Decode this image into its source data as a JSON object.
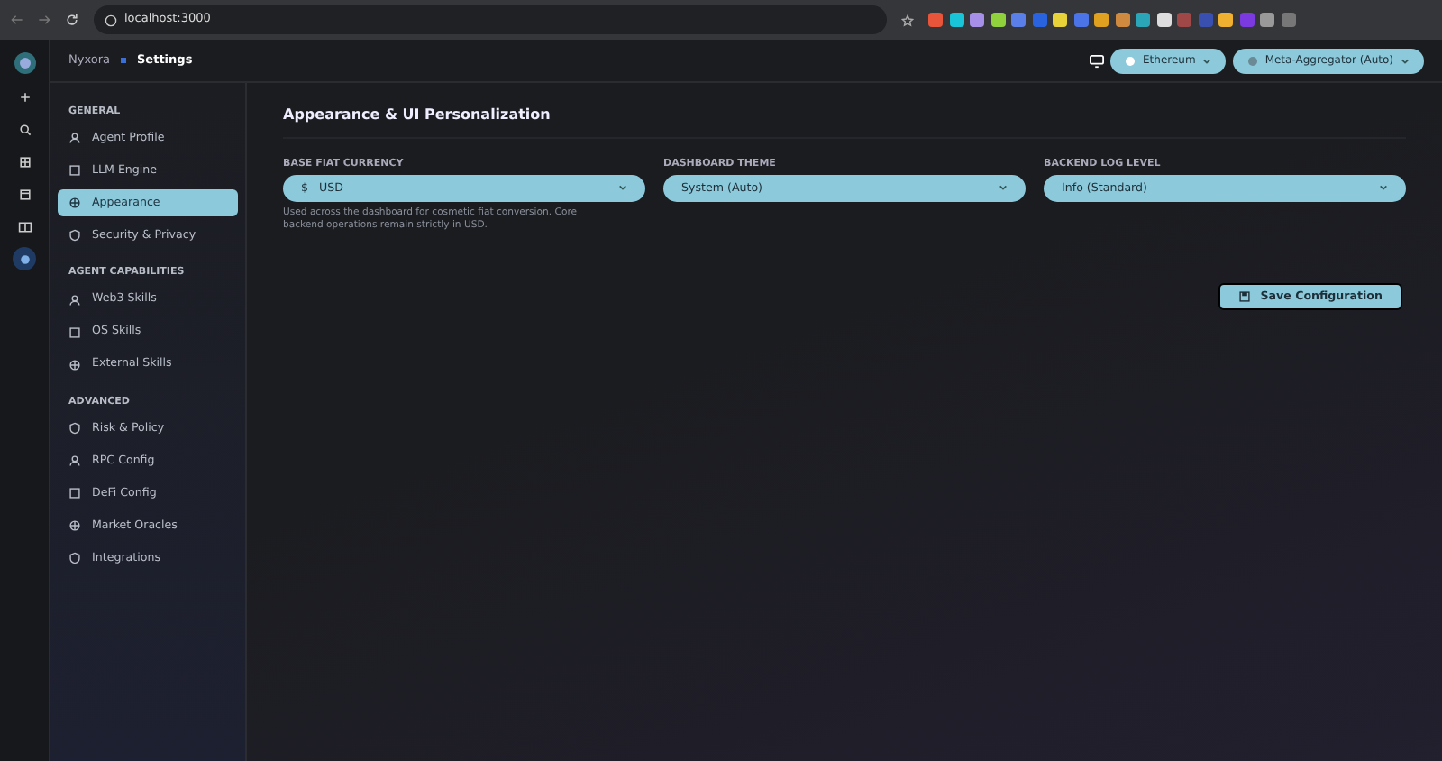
{
  "browser": {
    "url": "localhost:3000"
  },
  "rail": {
    "items": [
      {
        "selected": false
      },
      {
        "selected": false
      },
      {
        "selected": false
      },
      {
        "selected": false
      },
      {
        "selected": false
      },
      {
        "selected": true
      }
    ]
  },
  "header": {
    "breadcrumb": [
      "Nyxora",
      "Settings"
    ],
    "network": "Ethereum",
    "router": "Meta-Aggregator (Auto)"
  },
  "sidebar": {
    "sections": [
      {
        "title": "GENERAL",
        "items": [
          {
            "label": "Agent Profile",
            "selected": false
          },
          {
            "label": "LLM Engine",
            "selected": false
          },
          {
            "label": "Appearance",
            "selected": true
          },
          {
            "label": "Security & Privacy",
            "selected": false
          }
        ]
      },
      {
        "title": "AGENT CAPABILITIES",
        "items": [
          {
            "label": "Web3 Skills",
            "selected": false
          },
          {
            "label": "OS Skills",
            "selected": false
          },
          {
            "label": "External Skills",
            "selected": false
          }
        ]
      },
      {
        "title": "ADVANCED",
        "items": [
          {
            "label": "Risk & Policy",
            "selected": false
          },
          {
            "label": "RPC Config",
            "selected": false
          },
          {
            "label": "DeFi Config",
            "selected": false
          },
          {
            "label": "Market Oracles",
            "selected": false
          },
          {
            "label": "Integrations",
            "selected": false
          }
        ]
      }
    ]
  },
  "panel": {
    "title": "Appearance & UI Personalization",
    "fields": [
      {
        "label": "BASE FIAT CURRENCY",
        "value": "USD",
        "prefix": "$",
        "help": "Used across the dashboard for cosmetic fiat conversion. Core backend operations remain strictly in USD."
      },
      {
        "label": "DASHBOARD THEME",
        "value": "System (Auto)"
      },
      {
        "label": "BACKEND LOG LEVEL",
        "value": "Info (Standard)"
      }
    ],
    "save": "Save Configuration"
  }
}
